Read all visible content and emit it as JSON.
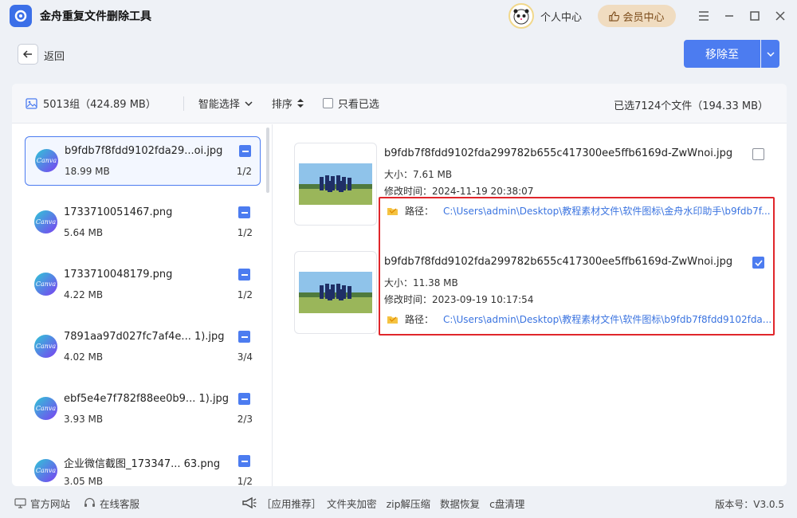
{
  "app": {
    "title": "金舟重复文件删除工具"
  },
  "header": {
    "personal_center": "个人中心",
    "vip_center": "会员中心"
  },
  "nav": {
    "back_label": "返回",
    "move_to_label": "移除至"
  },
  "toolbar": {
    "group_summary": "5013组（424.89 MB）",
    "smart_select": "智能选择",
    "sort": "排序",
    "only_selected": "只看已选",
    "selection_summary": "已选7124个文件（194.33 MB）"
  },
  "groups": [
    {
      "name": "b9fdb7f8fdd9102fda29...oi.jpg",
      "size": "18.99 MB",
      "count": "1/2",
      "icon": "Canva"
    },
    {
      "name": "1733710051467.png",
      "size": "5.64 MB",
      "count": "1/2",
      "icon": "Canva"
    },
    {
      "name": "1733710048179.png",
      "size": "4.22 MB",
      "count": "1/2",
      "icon": "Canva"
    },
    {
      "name": "7891aa97d027fc7af4e... 1).jpg",
      "size": "4.02 MB",
      "count": "3/4",
      "icon": "Canva"
    },
    {
      "name": "ebf5e4e7f782f88ee0b9... 1).jpg",
      "size": "3.93 MB",
      "count": "2/3",
      "icon": "Canva"
    },
    {
      "name": "企业微信截图_173347... 63.png",
      "size": "3.05 MB",
      "count": "1/2",
      "icon": "Canva"
    }
  ],
  "files": [
    {
      "name": "b9fdb7f8fdd9102fda299782b655c417300ee5ffb6169d-ZwWnoi.jpg",
      "size": "大小：7.61 MB",
      "modified": "修改时间：2024-11-19 20:38:07",
      "path_label": "路径：",
      "path": "C:\\Users\\admin\\Desktop\\教程素材文件\\软件图标\\金舟水印助手\\b9fdb7f...",
      "checked": false
    },
    {
      "name": "b9fdb7f8fdd9102fda299782b655c417300ee5ffb6169d-ZwWnoi.jpg",
      "size": "大小：11.38 MB",
      "modified": "修改时间：2023-09-19 10:17:54",
      "path_label": "路径：",
      "path": "C:\\Users\\admin\\Desktop\\教程素材文件\\软件图标\\b9fdb7f8fdd9102fda...",
      "checked": true
    }
  ],
  "footer": {
    "official_site": "官方网站",
    "online_service": "在线客服",
    "recommend": "［应用推荐］",
    "folder_encrypt": "文件夹加密",
    "zip": "zip解压缩",
    "data_recovery": "数据恢复",
    "c_clean": "c盘清理",
    "version": "版本号：V3.0.5"
  },
  "colors": {
    "accent": "#4c7cf0",
    "highlight_border": "#e0262b",
    "path_link": "#3b74e0",
    "vip_bg": "#f0dcc0"
  }
}
